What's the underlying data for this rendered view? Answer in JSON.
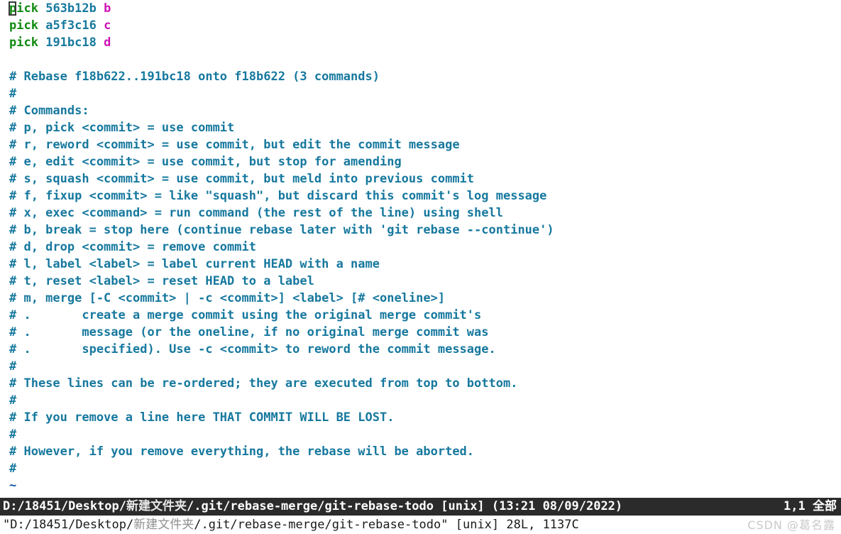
{
  "editor": {
    "name": "vim",
    "mode": "normal",
    "cursor_position": "1,1",
    "colors": {
      "command_keyword": "#0f8a0f",
      "commit_hash": "#177a9e",
      "commit_message": "#cc14b4",
      "comment": "#16789e",
      "tilde": "#0e52a8",
      "statusline_bg": "#2b2b2b",
      "statusline_fg": "#ffffff",
      "background": "#ffffff",
      "watermark": "#c9c9c9"
    }
  },
  "todo_lines": [
    {
      "command": "pick",
      "hash": "563b12b",
      "message": "b"
    },
    {
      "command": "pick",
      "hash": "a5f3c16",
      "message": "c"
    },
    {
      "command": "pick",
      "hash": "191bc18",
      "message": "d"
    }
  ],
  "buffer_lines": [
    "",
    "# Rebase f18b622..191bc18 onto f18b622 (3 commands)",
    "#",
    "# Commands:",
    "# p, pick <commit> = use commit",
    "# r, reword <commit> = use commit, but edit the commit message",
    "# e, edit <commit> = use commit, but stop for amending",
    "# s, squash <commit> = use commit, but meld into previous commit",
    "# f, fixup <commit> = like \"squash\", but discard this commit's log message",
    "# x, exec <command> = run command (the rest of the line) using shell",
    "# b, break = stop here (continue rebase later with 'git rebase --continue')",
    "# d, drop <commit> = remove commit",
    "# l, label <label> = label current HEAD with a name",
    "# t, reset <label> = reset HEAD to a label",
    "# m, merge [-C <commit> | -c <commit>] <label> [# <oneline>]",
    "# .       create a merge commit using the original merge commit's",
    "# .       message (or the oneline, if no original merge commit was",
    "# .       specified). Use -c <commit> to reword the commit message.",
    "#",
    "# These lines can be re-ordered; they are executed from top to bottom.",
    "#",
    "# If you remove a line here THAT COMMIT WILL BE LOST.",
    "#",
    "# However, if you remove everything, the rebase will be aborted.",
    "#"
  ],
  "filler_tilde": "~",
  "statusline": {
    "file_path_prefix": "D:/18451/Desktop/",
    "file_path_cjk": "新建文件夹",
    "file_path_suffix": "/.git/rebase-merge/git-rebase-todo",
    "file_format": "[unix]",
    "timestamp": "(13:21 08/09/2022)",
    "position": "1,1",
    "scroll_indicator": "全部"
  },
  "cmdline": {
    "quote_open": "\"D:/18451/Desktop/",
    "path_cjk": "新建文件夹",
    "quote_rest": "/.git/rebase-merge/git-rebase-todo\"",
    "file_format": "[unix]",
    "stats": "28L, 1137C"
  },
  "watermark": {
    "text": "CSDN @葛名露"
  }
}
